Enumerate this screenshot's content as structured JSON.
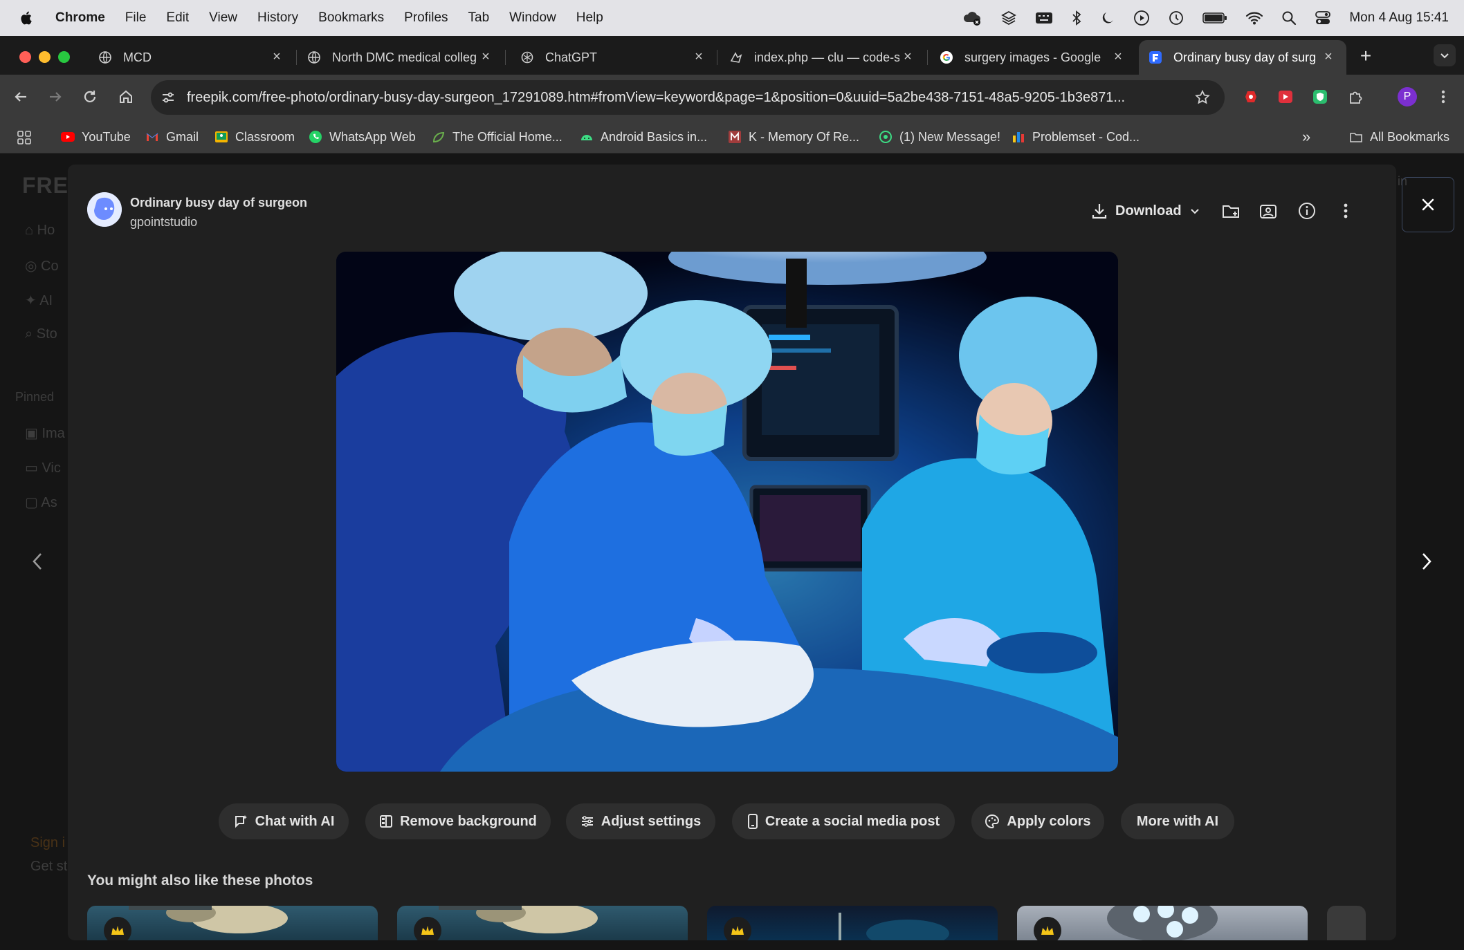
{
  "menubar": {
    "apple_icon": "apple-logo-icon",
    "items": [
      "Chrome",
      "File",
      "Edit",
      "View",
      "History",
      "Bookmarks",
      "Profiles",
      "Tab",
      "Window",
      "Help"
    ],
    "clock": "Mon 4 Aug  15:41"
  },
  "tabs": [
    {
      "title": "MCD",
      "icon": "globe-icon"
    },
    {
      "title": "North DMC medical colleg",
      "icon": "globe-icon"
    },
    {
      "title": "ChatGPT",
      "icon": "chatgpt-icon"
    },
    {
      "title": "index.php — clu — code-s",
      "icon": "code-server-icon"
    },
    {
      "title": "surgery images - Google",
      "icon": "google-icon"
    },
    {
      "title": "Ordinary busy day of surg",
      "icon": "freepik-icon",
      "active": true
    }
  ],
  "toolbar": {
    "url": "freepik.com/free-photo/ordinary-busy-day-surgeon_17291089.htm#fromView=keyword&page=1&position=0&uuid=5a2be438-7151-48a5-9205-1b3e871...",
    "profile_initial": "P"
  },
  "bookmarks": {
    "items": [
      "YouTube",
      "Gmail",
      "Classroom",
      "WhatsApp Web",
      "The Official Home...",
      "Android Basics in...",
      "K - Memory Of Re...",
      "(1) New Message!",
      "Problemset - Cod..."
    ],
    "overflow": "»",
    "all": "All Bookmarks"
  },
  "background": {
    "logo": "FRE",
    "nav": [
      "Ho",
      "Co",
      "AI",
      "Sto"
    ],
    "pinned_label": "Pinned",
    "pinned": [
      "Ima",
      "Vic",
      "As"
    ],
    "sign_in": "Sign i",
    "get_started": "Get st",
    "corner_text": "in"
  },
  "modal": {
    "title": "Ordinary busy day of surgeon",
    "author": "gpointstudio",
    "download_label": "Download",
    "ai_actions": [
      "Chat with AI",
      "Remove background",
      "Adjust settings",
      "Create a social media post",
      "Apply colors",
      "More with AI"
    ],
    "suggest_heading": "You might also like these photos"
  },
  "colors": {
    "accent": "#2f6bff",
    "modal_bg": "#202020",
    "button_bg": "#2e2e2e"
  }
}
